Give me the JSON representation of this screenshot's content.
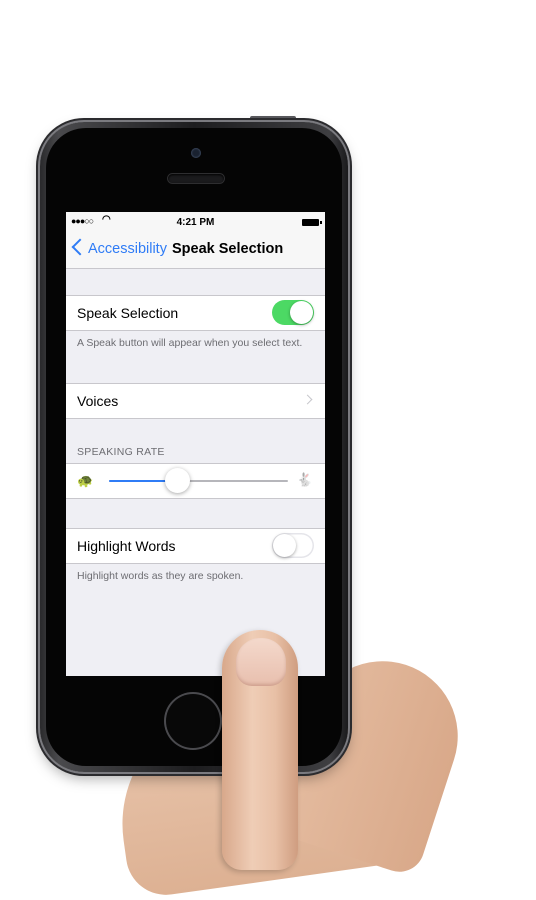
{
  "status_bar": {
    "signal": "●●●○○",
    "time": "4:21 PM"
  },
  "nav": {
    "back_label": "Accessibility",
    "title": "Speak Selection"
  },
  "speak_selection": {
    "label": "Speak Selection",
    "enabled": true,
    "footer": "A Speak button will appear when you select text."
  },
  "voices": {
    "label": "Voices"
  },
  "speaking_rate": {
    "header": "SPEAKING RATE",
    "value": 0.38
  },
  "highlight_words": {
    "label": "Highlight Words",
    "enabled": false,
    "footer": "Highlight words as they are spoken."
  },
  "colors": {
    "accent": "#2f7cf6",
    "toggle_on": "#4cd964",
    "background": "#efeff4"
  },
  "icons": {
    "slow": "turtle-icon",
    "fast": "rabbit-icon"
  }
}
